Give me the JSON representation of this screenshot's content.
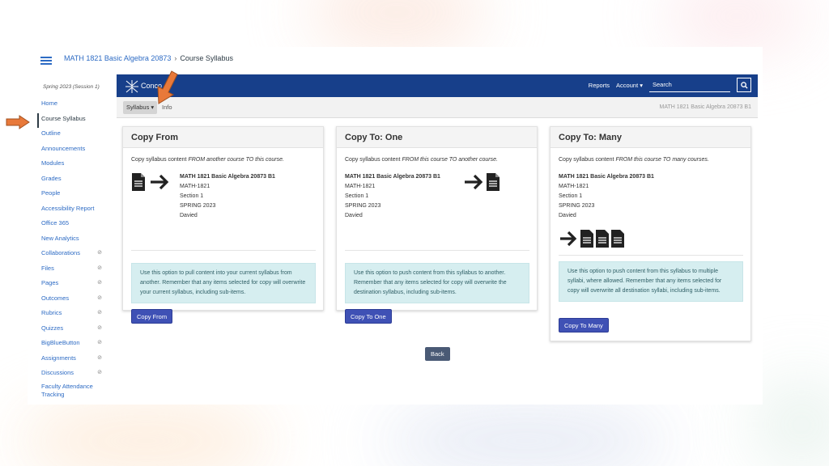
{
  "breadcrumb": {
    "course_link": "MATH 1821 Basic Algebra 20873",
    "separator": "›",
    "current": "Course Syllabus"
  },
  "sidebar": {
    "term": "Spring 2023 (Session 1)",
    "items": [
      {
        "label": "Home"
      },
      {
        "label": "Course Syllabus"
      },
      {
        "label": "Outline"
      },
      {
        "label": "Announcements"
      },
      {
        "label": "Modules"
      },
      {
        "label": "Grades"
      },
      {
        "label": "People"
      },
      {
        "label": "Accessibility Report"
      },
      {
        "label": "Office 365"
      },
      {
        "label": "New Analytics"
      },
      {
        "label": "Collaborations"
      },
      {
        "label": "Files"
      },
      {
        "label": "Pages"
      },
      {
        "label": "Outcomes"
      },
      {
        "label": "Rubrics"
      },
      {
        "label": "Quizzes"
      },
      {
        "label": "BigBlueButton"
      },
      {
        "label": "Assignments"
      },
      {
        "label": "Discussions"
      },
      {
        "label": "Faculty Attendance Tracking"
      }
    ]
  },
  "app": {
    "brand": "Conco",
    "nav": {
      "reports": "Reports",
      "account": "Account ▾"
    },
    "search_placeholder": "Search",
    "tabs": {
      "syllabus": "Syllabus ▾",
      "info": "Info"
    },
    "course_right": "MATH 1821 Basic Algebra 20873 B1"
  },
  "course": {
    "name": "MATH 1821 Basic Algebra 20873 B1",
    "code": "MATH-1821",
    "section": "Section 1",
    "term": "SPRING 2023",
    "instructor": "Davied"
  },
  "cards": {
    "copy_from": {
      "title": "Copy From",
      "desc_pre": "Copy syllabus content ",
      "desc_em": "FROM another course TO this course.",
      "alert": "Use this option to pull content into your current syllabus from another. Remember that any items selected for copy will overwrite your current syllabus, including sub-items.",
      "button": "Copy From"
    },
    "copy_one": {
      "title": "Copy To: One",
      "desc_pre": "Copy syllabus content ",
      "desc_em": "FROM this course TO another course.",
      "alert": "Use this option to push content from this syllabus to another. Remember that any items selected for copy will overwrite the destination syllabus, including sub-items.",
      "button": "Copy To One"
    },
    "copy_many": {
      "title": "Copy To: Many",
      "desc_pre": "Copy syllabus content ",
      "desc_em": "FROM this course TO many courses.",
      "alert": "Use this option to push content from this syllabus to multiple syllabi, where allowed. Remember that any items selected for copy will overwrite all destination syllabi, including sub-items.",
      "button": "Copy To Many"
    }
  },
  "back_button": "Back",
  "colors": {
    "topbar": "#173f8a",
    "button": "#3f51b5",
    "alert_bg": "#d6eef0",
    "annotation_arrow": "#e8793a"
  }
}
